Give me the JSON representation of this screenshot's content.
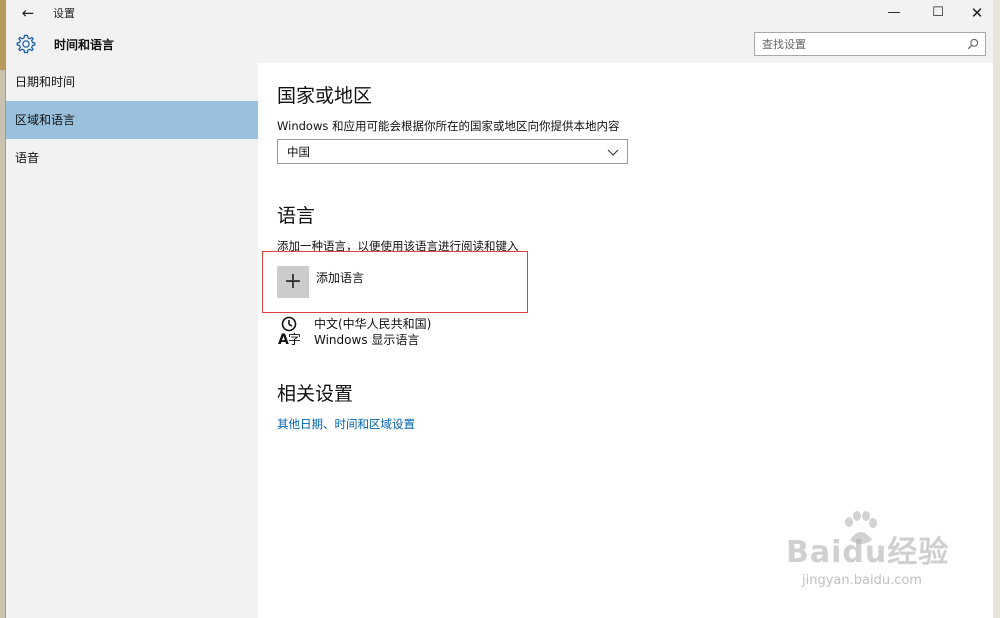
{
  "window": {
    "title": "设置",
    "back_glyph": "←",
    "min_glyph": "—",
    "max_glyph": "☐",
    "close_glyph": "✕"
  },
  "header": {
    "section_title": "时间和语言",
    "search_placeholder": "查找设置"
  },
  "sidebar": {
    "items": [
      {
        "label": "日期和时间",
        "active": false
      },
      {
        "label": "区域和语言",
        "active": true
      },
      {
        "label": "语音",
        "active": false
      }
    ]
  },
  "region": {
    "heading": "国家或地区",
    "description": "Windows 和应用可能会根据你所在的国家或地区向你提供本地内容",
    "selected_country": "中国"
  },
  "language": {
    "heading": "语言",
    "description": "添加一种语言，以便使用该语言进行阅读和键入",
    "add_label": "添加语言",
    "plus_glyph": "+",
    "installed": [
      {
        "name": "中文(中华人民共和国)",
        "sub": "Windows 显示语言"
      }
    ]
  },
  "related": {
    "heading": "相关设置",
    "link": "其他日期、时间和区域设置"
  },
  "watermark": {
    "logo_text": "Baidu经验",
    "url": "jingyan.baidu.com"
  },
  "colors": {
    "accent_selected": "#99c0dc",
    "link": "#0063b1",
    "highlight_border": "#e04040"
  }
}
